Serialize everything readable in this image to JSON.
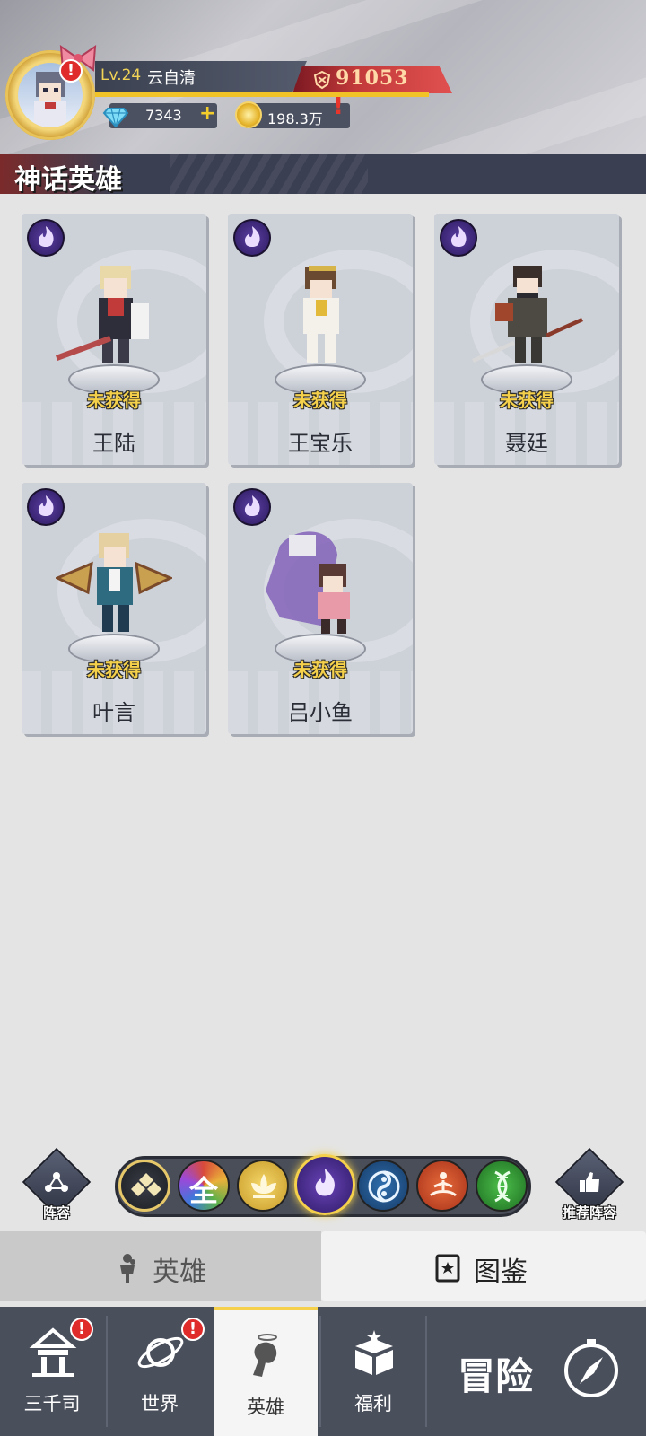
{
  "player": {
    "level_label": "Lv.24",
    "name": "云自清",
    "power": "91053",
    "gems": "7343",
    "gold": "198.3万",
    "alert_mark": "!"
  },
  "section": {
    "title": "神话英雄"
  },
  "heroes": [
    {
      "name": "王陆",
      "status": "未获得"
    },
    {
      "name": "王宝乐",
      "status": "未获得"
    },
    {
      "name": "聂廷",
      "status": "未获得"
    },
    {
      "name": "叶言",
      "status": "未获得"
    },
    {
      "name": "吕小鱼",
      "status": "未获得"
    }
  ],
  "side_buttons": {
    "lineup": "阵容",
    "recommended": "推荐阵容"
  },
  "filters": {
    "all_label": "全",
    "selected": "mythic"
  },
  "tabs": {
    "heroes": "英雄",
    "codex": "图鉴",
    "active": "heroes"
  },
  "nav": {
    "items": [
      {
        "label": "三千司"
      },
      {
        "label": "世界"
      },
      {
        "label": "英雄"
      },
      {
        "label": "福利"
      }
    ],
    "adventure": "冒险",
    "active": "英雄"
  },
  "colors": {
    "accent_gold": "#f4d04b",
    "power_red": "#c33a3a",
    "mythic_purple": "#3b2276"
  }
}
